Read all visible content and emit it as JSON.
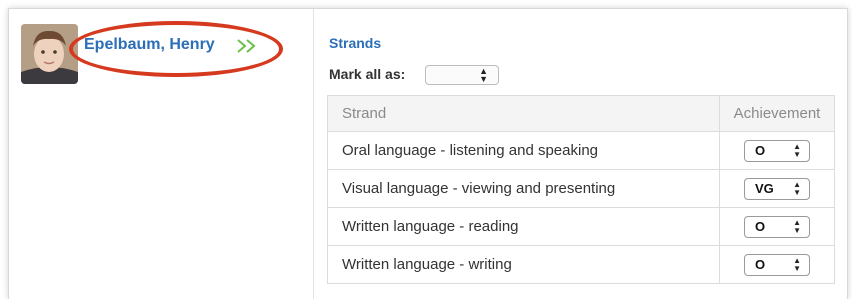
{
  "student": {
    "name": "Epelbaum, Henry",
    "next_icon": "double-right-arrow"
  },
  "strands": {
    "title": "Strands",
    "mark_all_label": "Mark all as:",
    "mark_all_value": "",
    "table": {
      "headers": [
        "Strand",
        "Achievement"
      ],
      "rows": [
        {
          "strand": "Oral language - listening and speaking",
          "achievement": "O"
        },
        {
          "strand": "Visual language - viewing and presenting",
          "achievement": "VG"
        },
        {
          "strand": "Written language - reading",
          "achievement": "O"
        },
        {
          "strand": "Written language - writing",
          "achievement": "O"
        }
      ]
    }
  },
  "colors": {
    "link": "#2a6fb7",
    "highlight": "#d63a1e",
    "next_icon": "#6cc04a"
  }
}
